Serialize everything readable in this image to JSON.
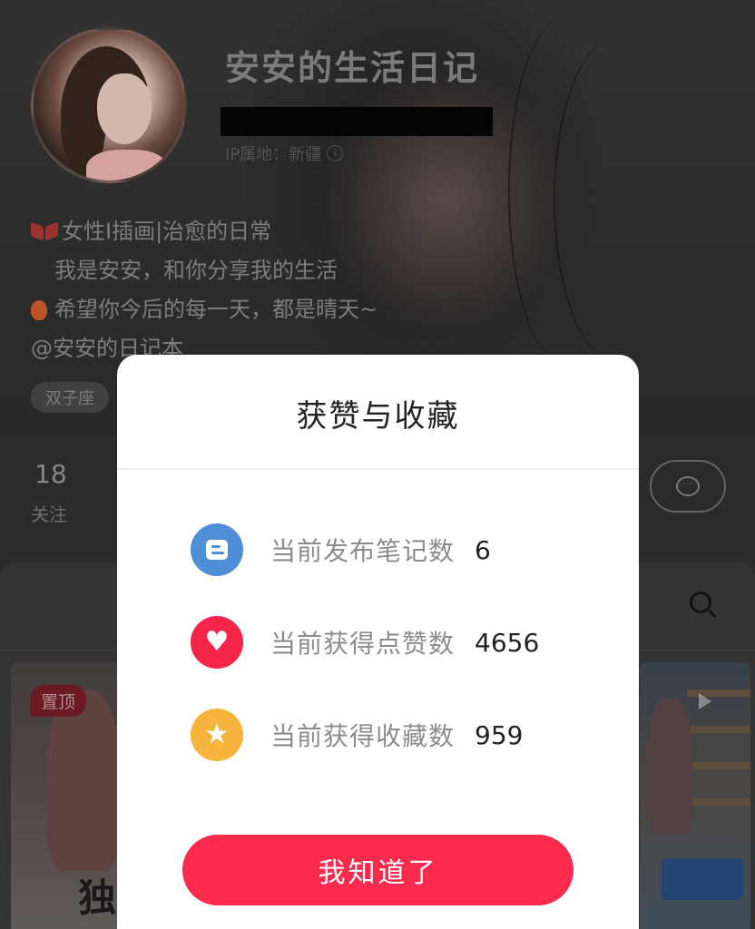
{
  "profile": {
    "nickname": "安安的生活日记",
    "ip_location": "IP属地：新疆",
    "bio_lines": [
      "女性I插画|治愈的日常",
      "我是安安，和你分享我的生活",
      "希望你今后的每一天，都是晴天~",
      "@安安的日记本"
    ],
    "tag": "双子座",
    "following_count": "18",
    "following_label": "关注"
  },
  "notes_grid": {
    "pinned_badge": "置顶",
    "thumbnail_caption": "独"
  },
  "modal": {
    "title": "获赞与收藏",
    "rows": [
      {
        "label": "当前发布笔记数",
        "value": "6",
        "icon": "note-icon",
        "color": "#4f8fd8"
      },
      {
        "label": "当前获得点赞数",
        "value": "4656",
        "icon": "heart-icon",
        "color": "#f5254a"
      },
      {
        "label": "当前获得收藏数",
        "value": "959",
        "icon": "star-icon",
        "color": "#f6b43f"
      }
    ],
    "confirm_label": "我知道了"
  },
  "colors": {
    "accent": "#fc2a4c",
    "note_blue": "#4f8fd8",
    "like_red": "#f5254a",
    "collect_yellow": "#f6b43f"
  }
}
